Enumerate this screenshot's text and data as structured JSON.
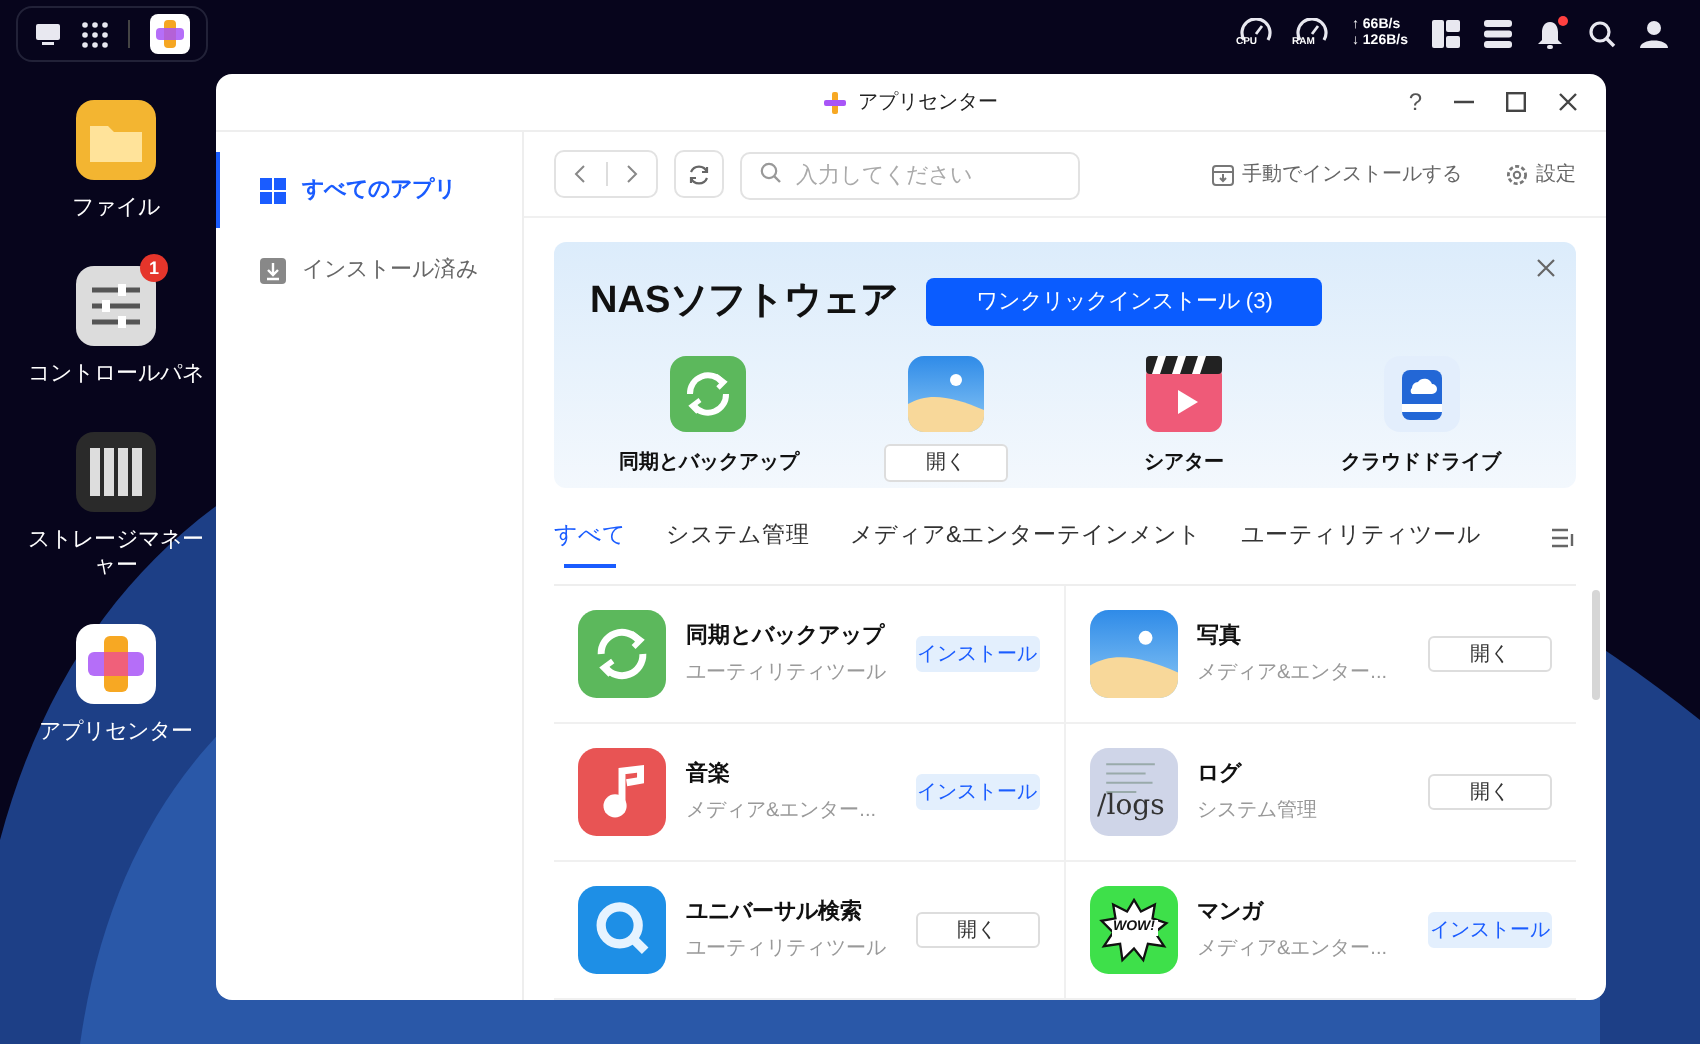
{
  "top_bar": {
    "gauges": [
      "CPU",
      "RAM"
    ],
    "upload": "↑ 66B/s",
    "download": "↓ 126B/s",
    "notification_dot": true
  },
  "desktop": {
    "apps": [
      {
        "label_lines": [
          "ファイル"
        ]
      },
      {
        "label_lines": [
          "コントロールパネ"
        ],
        "badge": "1"
      },
      {
        "label_lines": [
          "ストレージマネー",
          "ャー"
        ]
      },
      {
        "label_lines": [
          "アプリセンター"
        ]
      }
    ]
  },
  "window": {
    "title": "アプリセンター",
    "help": "?"
  },
  "sidebar": {
    "items": [
      {
        "label": "すべてのアプリ",
        "selected": true
      },
      {
        "label": "インストール済み",
        "selected": false
      }
    ]
  },
  "toolbar": {
    "search_placeholder": "入力してください",
    "manual_install": "手動でインストールする",
    "settings": "設定"
  },
  "banner": {
    "title": "NASソフトウェア",
    "button": "ワンクリックインストール (3)",
    "apps": [
      {
        "kind": "name",
        "text": "同期とバックアップ"
      },
      {
        "kind": "button",
        "text": "開く"
      },
      {
        "kind": "name",
        "text": "シアター"
      },
      {
        "kind": "name",
        "text": "クラウドドライブ"
      }
    ]
  },
  "tabs": [
    {
      "label": "すべて",
      "selected": true
    },
    {
      "label": "システム管理",
      "selected": false
    },
    {
      "label": "メディア&エンターテインメント",
      "selected": false
    },
    {
      "label": "ユーティリティツール",
      "selected": false
    }
  ],
  "apps": [
    {
      "name": "同期とバックアップ",
      "category": "ユーティリティツール",
      "kind": "install",
      "action": "インストール"
    },
    {
      "name": "写真",
      "category": "メディア&エンター...",
      "kind": "open",
      "action": "開く"
    },
    {
      "name": "音楽",
      "category": "メディア&エンター...",
      "kind": "install",
      "action": "インストール"
    },
    {
      "name": "ログ",
      "category": "システム管理",
      "kind": "open",
      "action": "開く",
      "icon_text": "/logs"
    },
    {
      "name": "ユニバーサル検索",
      "category": "ユーティリティツール",
      "kind": "open",
      "action": "開く"
    },
    {
      "name": "マンガ",
      "category": "メディア&エンター...",
      "kind": "install",
      "action": "インストール",
      "icon_text": "WOW!"
    }
  ]
}
